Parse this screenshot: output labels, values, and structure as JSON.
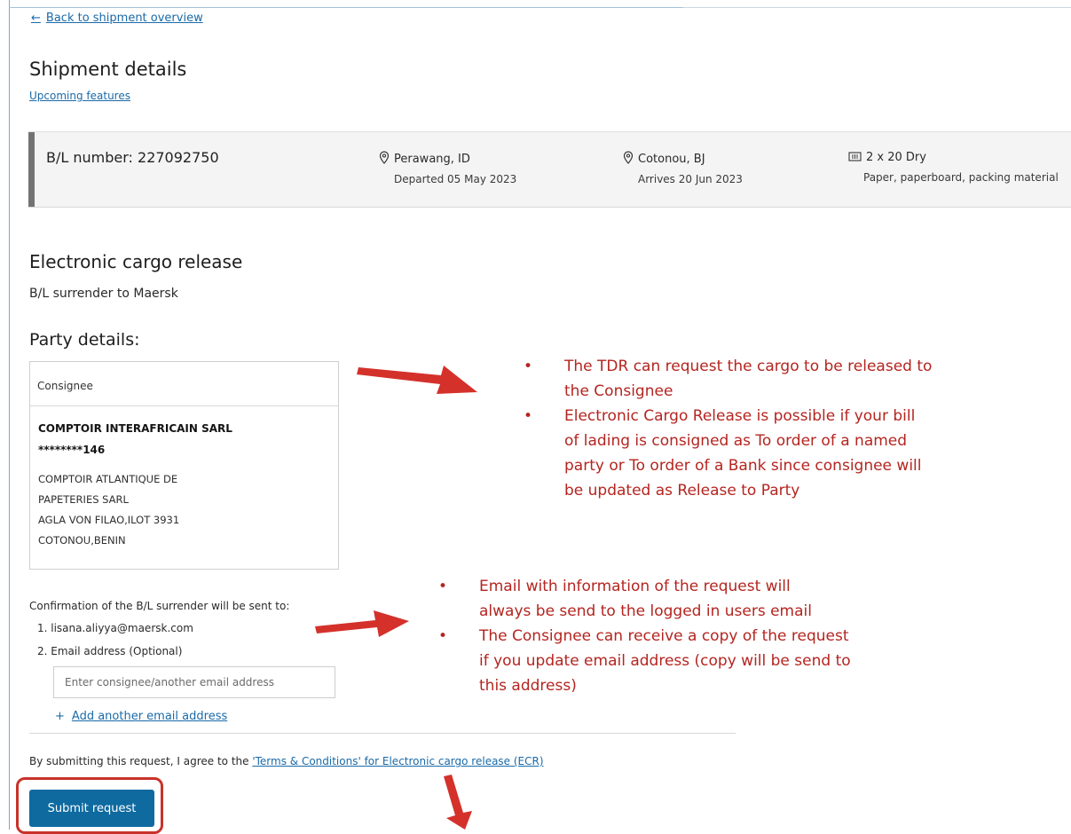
{
  "header": {
    "back_link": "Back to shipment overview",
    "title": "Shipment details",
    "upcoming_link": "Upcoming features"
  },
  "bl_card": {
    "bl_number": "B/L number: 227092750",
    "origin": "Perawang, ID",
    "origin_sub": "Departed 05 May 2023",
    "destination": "Cotonou, BJ",
    "destination_sub": "Arrives 20 Jun 2023",
    "container": "2 x 20 Dry",
    "commodity": "Paper, paperboard, packing material"
  },
  "release": {
    "title": "Electronic cargo release",
    "subtitle": "B/L surrender to Maersk",
    "party_title": "Party details:"
  },
  "party_card": {
    "role": "Consignee",
    "name": "COMPTOIR INTERAFRICAIN SARL",
    "code": "********146",
    "address_lines": [
      "COMPTOIR ATLANTIQUE DE",
      "PAPETERIES SARL",
      "AGLA VON FILAO,ILOT 3931",
      "COTONOU,BENIN"
    ]
  },
  "confirmation": {
    "text": "Confirmation of the B/L surrender will be sent to:",
    "email_1": "1. lisana.aliyya@maersk.com",
    "email_2_label": "2. Email address (Optional)",
    "email_placeholder": "Enter consignee/another email address",
    "add_email": "Add another email address"
  },
  "terms": {
    "prefix": "By submitting this request, I agree to the ",
    "link": "'Terms & Conditions' for Electronic cargo release (ECR)"
  },
  "submit_label": "Submit request",
  "annotations": {
    "callout_1": [
      [
        "The TDR can request the cargo to be released to",
        "the Consignee"
      ],
      [
        "Electronic Cargo Release is possible if your bill",
        "of lading is consigned as To order of a named",
        "party or To order of a Bank since consignee will",
        "be updated as Release to Party"
      ]
    ],
    "callout_2": [
      [
        "Email with information of the request will",
        "always be send to the logged in users email"
      ],
      [
        "The Consignee can receive a copy of the request",
        "if you update email address (copy will be send to",
        "this address)"
      ]
    ],
    "bullet": "•",
    "annotation_color": "#c8322a"
  },
  "colors": {
    "link": "#1a6aa8",
    "button": "#0f6aa0",
    "card_bg": "#f4f4f4"
  }
}
